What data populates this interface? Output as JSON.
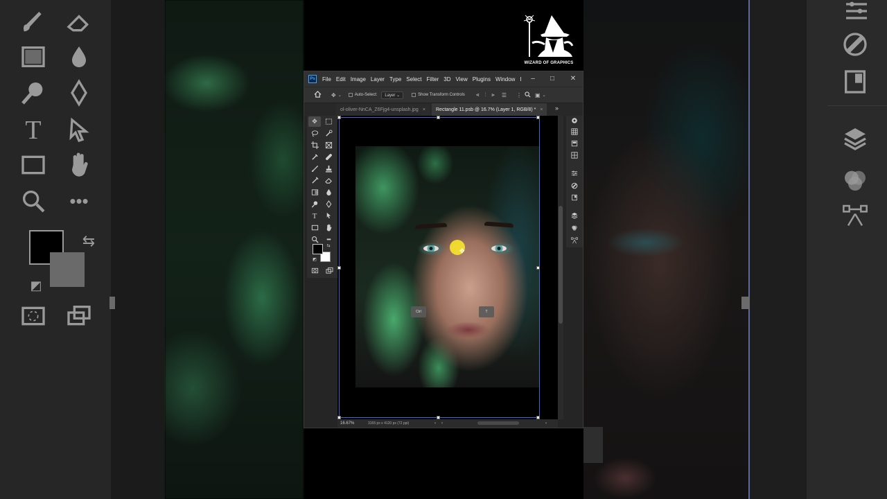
{
  "watermark": {
    "brand": "WIZARD OF GRAPHICS"
  },
  "app": {
    "logo": "Ps",
    "menu": [
      "File",
      "Edit",
      "Image",
      "Layer",
      "Type",
      "Select",
      "Filter",
      "3D",
      "Plugins",
      "Window",
      "I"
    ],
    "window_controls": {
      "minimize": "–",
      "maximize": "□",
      "close": "✕"
    }
  },
  "options_bar": {
    "auto_select_label": "Auto-Select:",
    "auto_select_value": "Layer",
    "show_transform_label": "Show Transform Controls"
  },
  "tabs": [
    {
      "label": "ol-oliver-NnCA_Z6Fjg4-unsplash.jpg",
      "close": "×",
      "active": false
    },
    {
      "label": "Rectangle 11.psb @ 16.7% (Layer 1, RGB/8) *",
      "close": "×",
      "active": true
    }
  ],
  "tabs_overflow": "»",
  "canvas": {
    "hint_ctrl": "Ctrl",
    "hint_t": "T"
  },
  "status": {
    "zoom": "16.67%",
    "doc_info": "3155 px x 4120 px (72 ppi)"
  },
  "colors": {
    "foreground": "#000000",
    "background": "#ffffff",
    "accent": "#3a6bd8",
    "cursor_highlight": "#ffec28"
  },
  "icons": {
    "toolbar": [
      "move-icon",
      "marquee-icon",
      "lasso-icon",
      "quick-select-icon",
      "crop-icon",
      "frame-icon",
      "eyedropper-icon",
      "healing-brush-icon",
      "brush-icon",
      "stamp-icon",
      "history-brush-icon",
      "eraser-icon",
      "gradient-icon",
      "blur-icon",
      "dodge-icon",
      "pen-icon",
      "type-icon",
      "path-select-icon",
      "rectangle-icon",
      "hand-icon",
      "zoom-icon",
      "more-tools-icon"
    ],
    "panels": [
      "learn-icon",
      "swatches-icon",
      "gradients-icon",
      "patterns-icon",
      "adjustments-icon",
      "libraries-icon",
      "properties-icon",
      "layers-icon",
      "channels-icon",
      "paths-icon"
    ]
  }
}
